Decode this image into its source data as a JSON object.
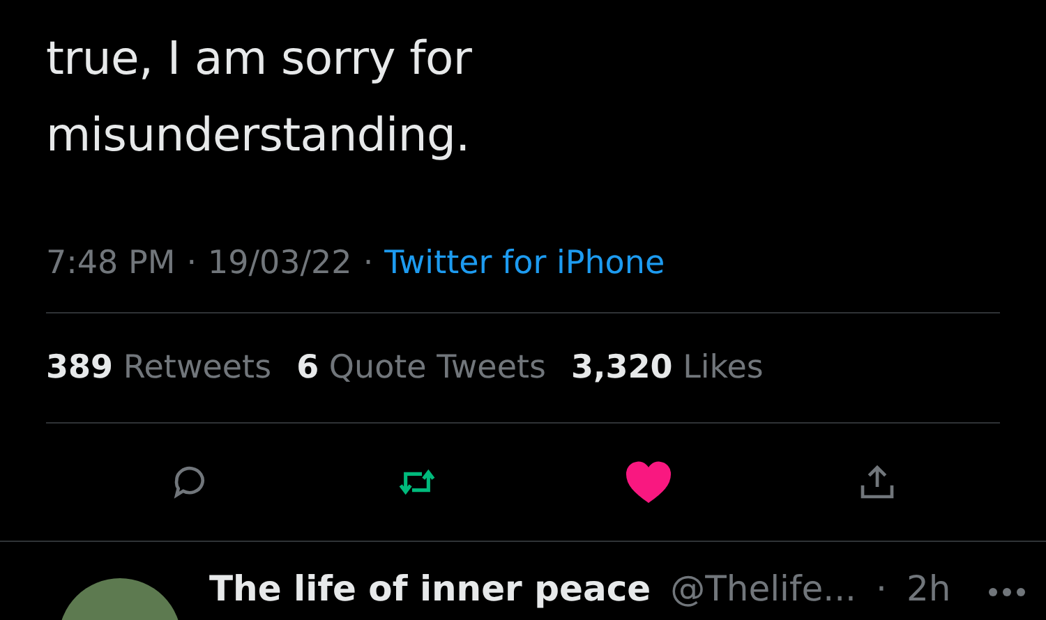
{
  "tweet": {
    "text_lines": [
      "true, I am sorry for",
      "misunderstanding."
    ],
    "time": "7:48 PM",
    "sep_1": "·",
    "date": "19/03/22",
    "sep_2": "·",
    "source": "Twitter for iPhone",
    "stats": [
      {
        "count": "389",
        "label": "Retweets"
      },
      {
        "count": "6",
        "label": "Quote Tweets"
      },
      {
        "count": "3,320",
        "label": "Likes"
      }
    ],
    "actions": [
      {
        "kind": "reply",
        "on": false
      },
      {
        "kind": "retweet",
        "on": true
      },
      {
        "kind": "like",
        "on": true
      },
      {
        "kind": "share",
        "on": false
      }
    ]
  },
  "reply": {
    "name": "The life of inner peace",
    "handle": "@Thelife...",
    "sep": "·",
    "age": "2h"
  }
}
